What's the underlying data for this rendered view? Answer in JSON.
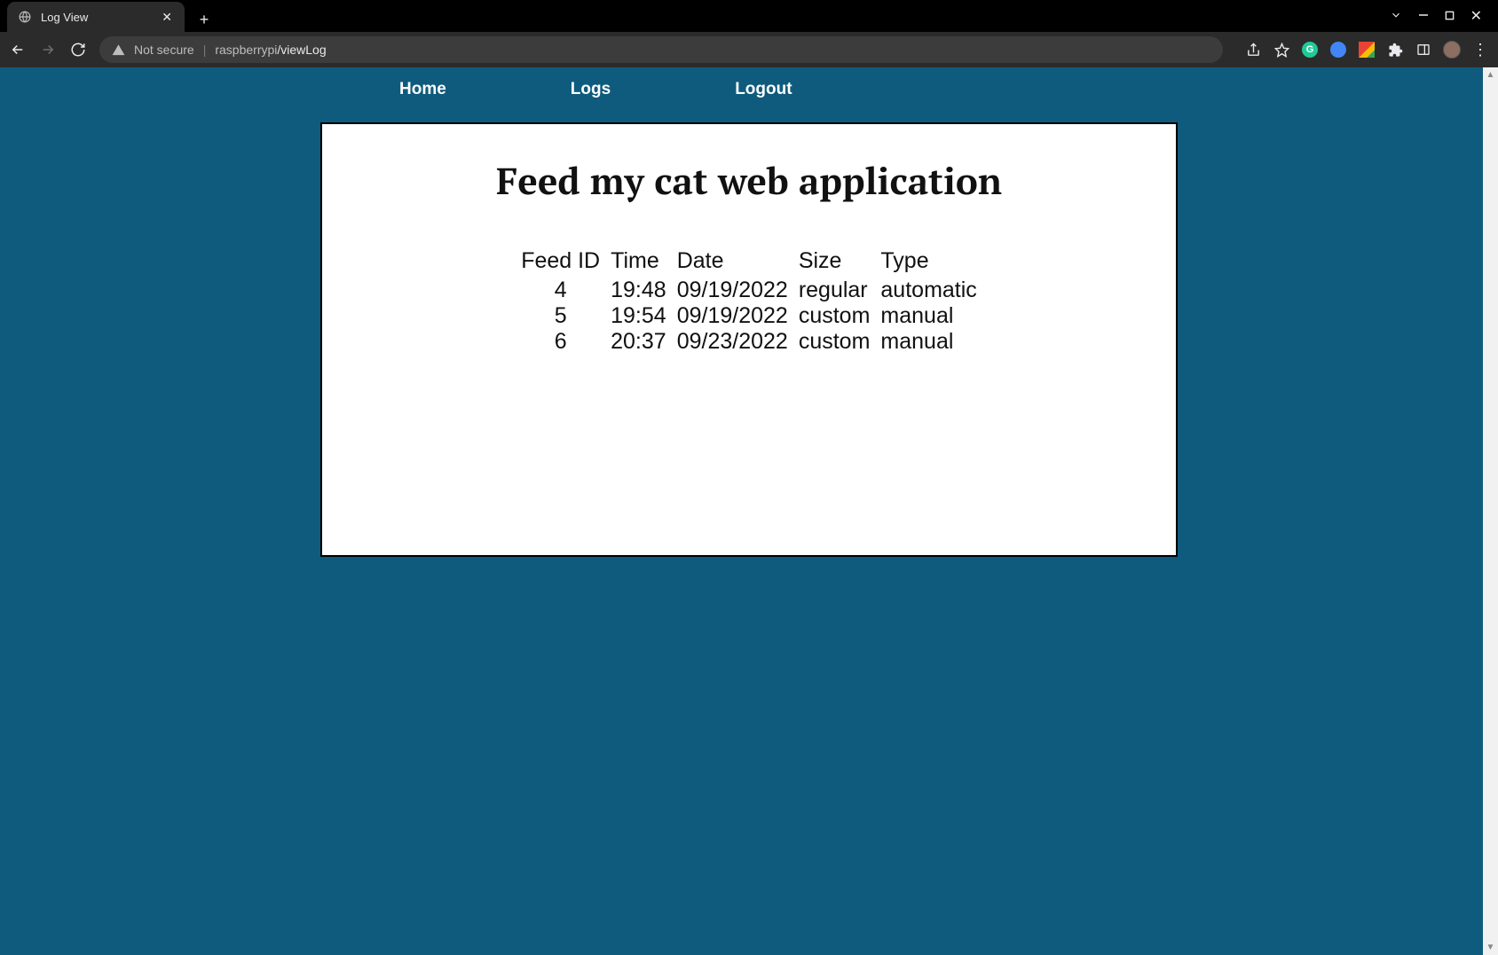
{
  "browser": {
    "tab_title": "Log View",
    "address_prefix": "Not secure",
    "address_host": "raspberrypi",
    "address_path": "/viewLog"
  },
  "nav": {
    "home": "Home",
    "logs": "Logs",
    "logout": "Logout"
  },
  "page": {
    "title": "Feed my cat web application"
  },
  "table": {
    "headers": {
      "id": "Feed ID",
      "time": "Time",
      "date": "Date",
      "size": "Size",
      "type": "Type"
    },
    "rows": [
      {
        "id": "4",
        "time": "19:48",
        "date": "09/19/2022",
        "size": "regular",
        "type": "automatic"
      },
      {
        "id": "5",
        "time": "19:54",
        "date": "09/19/2022",
        "size": "custom",
        "type": "manual"
      },
      {
        "id": "6",
        "time": "20:37",
        "date": "09/23/2022",
        "size": "custom",
        "type": "manual"
      }
    ]
  }
}
